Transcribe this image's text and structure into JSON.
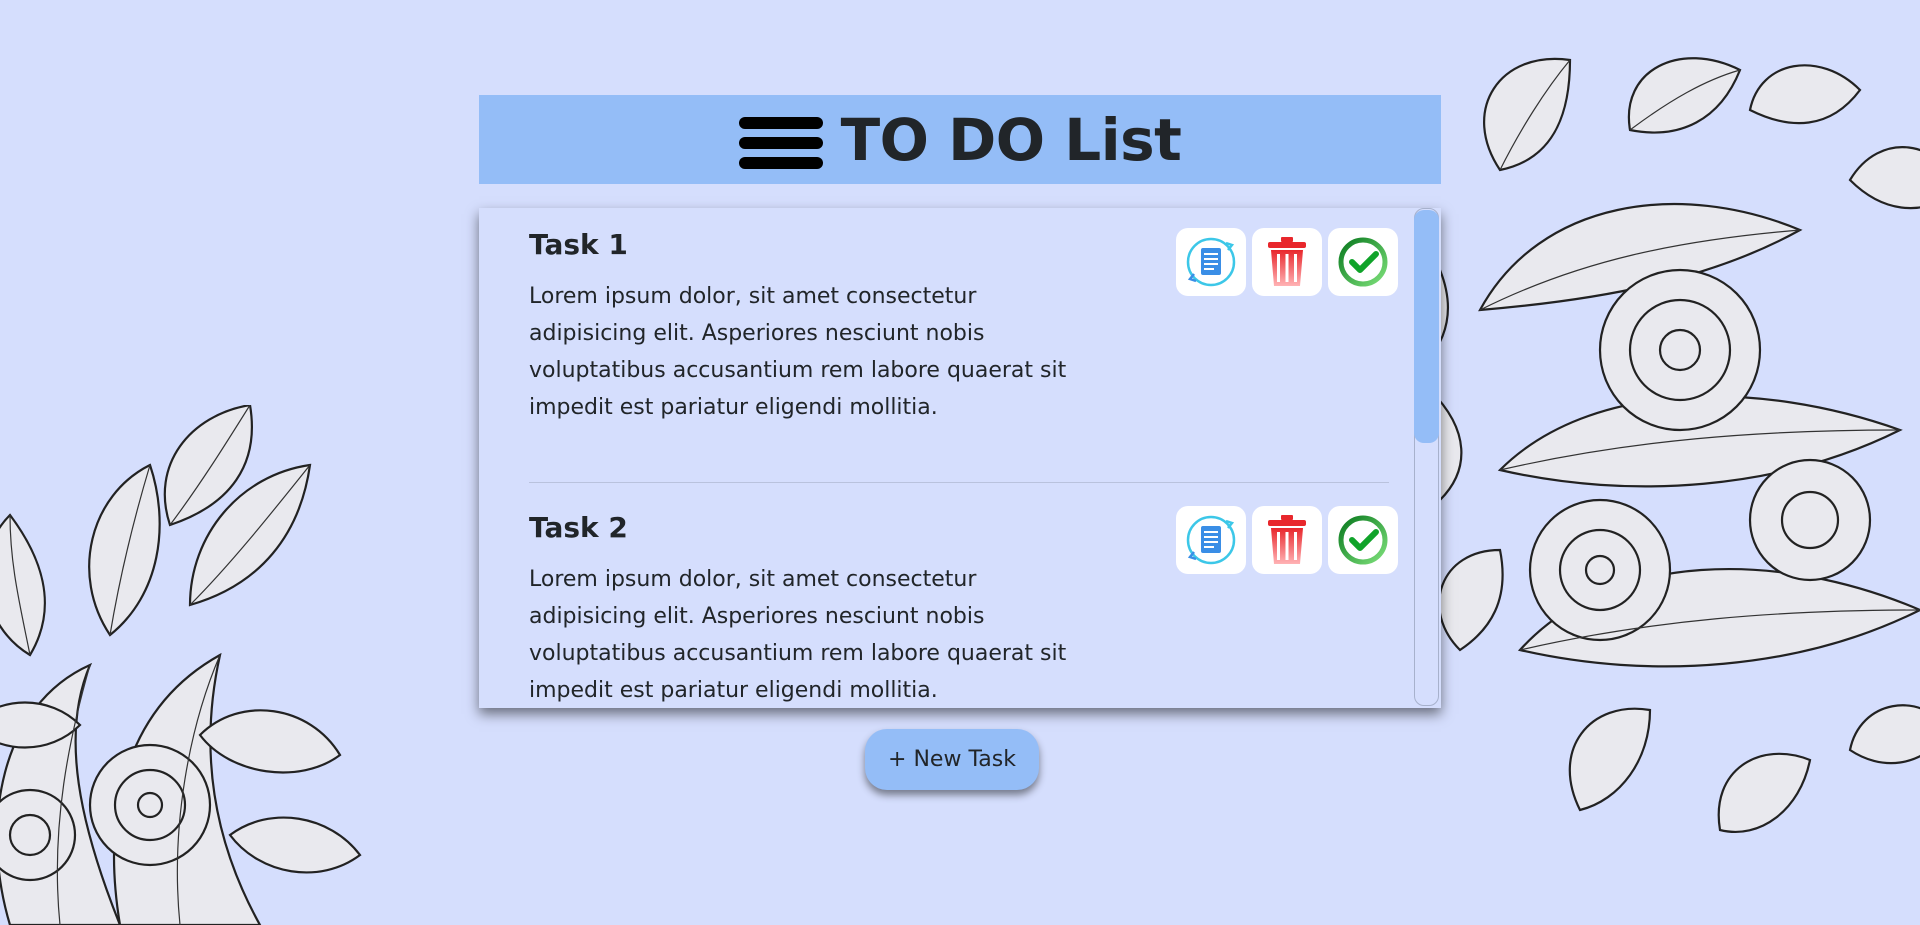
{
  "header": {
    "title": "TO DO List",
    "menu_icon": "hamburger-menu-icon"
  },
  "tasks": [
    {
      "title": "Task 1",
      "text": "Lorem ipsum dolor, sit amet consectetur adipisicing elit. Asperiores nesciunt nobis voluptatibus accusantium rem labore quaerat sit impedit est pariatur eligendi mollitia.",
      "actions": [
        "edit-document-icon",
        "trash-icon",
        "check-circle-icon"
      ]
    },
    {
      "title": "Task 2",
      "text": "Lorem ipsum dolor, sit amet consectetur adipisicing elit. Asperiores nesciunt nobis voluptatibus accusantium rem labore quaerat sit impedit est pariatur eligendi mollitia.",
      "actions": [
        "edit-document-icon",
        "trash-icon",
        "check-circle-icon"
      ]
    }
  ],
  "new_task_button": {
    "label": "+ New Task"
  },
  "colors": {
    "background": "#d5defd",
    "accent": "#94bdf7",
    "text": "#212529",
    "delete": "#e8272c",
    "done": "#12b52a",
    "edit": "#3a8ee6"
  }
}
